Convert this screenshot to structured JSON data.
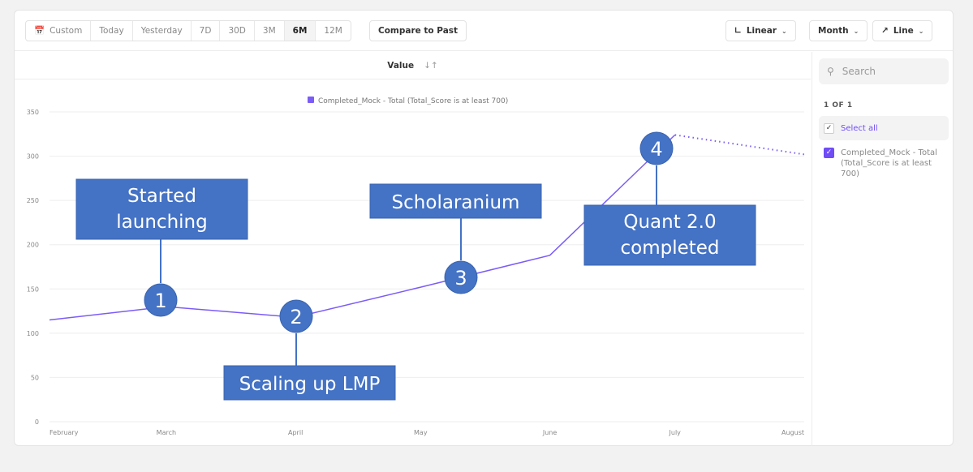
{
  "toolbar": {
    "ranges": [
      "Custom",
      "Today",
      "Yesterday",
      "7D",
      "30D",
      "3M",
      "6M",
      "12M"
    ],
    "active_range": "6M",
    "compare_label": "Compare to Past",
    "scale_label": "Linear",
    "interval_label": "Month",
    "chart_type_label": "Line"
  },
  "value_header": {
    "label": "Value"
  },
  "sidebar": {
    "search_placeholder": "Search",
    "count": "1 OF 1",
    "select_all": "Select all",
    "series_label": "Completed_Mock - Total (Total_Score is at least 700)"
  },
  "colors": {
    "series": "#7b5cf6",
    "annotation": "#4472c4",
    "accent": "#6f4cf5"
  },
  "chart_data": {
    "type": "line",
    "legend": "Completed_Mock - Total (Total_Score is at least 700)",
    "legend_position": "top-center",
    "grid": true,
    "ylim": [
      0,
      350
    ],
    "yticks": [
      0,
      50,
      100,
      150,
      200,
      250,
      300,
      350
    ],
    "xlim": [
      "2023-02-01",
      "2023-08-01"
    ],
    "xticks": [
      {
        "date": "2023-02-01",
        "label": "February"
      },
      {
        "date": "2023-03-01",
        "label": "March"
      },
      {
        "date": "2023-04-01",
        "label": "April"
      },
      {
        "date": "2023-05-01",
        "label": "May"
      },
      {
        "date": "2023-06-01",
        "label": "June"
      },
      {
        "date": "2023-07-01",
        "label": "July"
      },
      {
        "date": "2023-08-01",
        "label": "August"
      }
    ],
    "series": [
      {
        "name": "Completed_Mock - Total (Total_Score is at least 700)",
        "points": [
          {
            "x": "2023-02-01",
            "y": 115
          },
          {
            "x": "2023-03-01",
            "y": 130
          },
          {
            "x": "2023-04-01",
            "y": 118
          },
          {
            "x": "2023-05-01",
            "y": 152
          },
          {
            "x": "2023-06-01",
            "y": 188
          },
          {
            "x": "2023-07-01",
            "y": 324
          },
          {
            "x": "2023-08-01",
            "y": 302,
            "incomplete": true
          }
        ]
      }
    ],
    "annotations": [
      {
        "num": "1",
        "text": "Started launching"
      },
      {
        "num": "2",
        "text": "Scaling up LMP"
      },
      {
        "num": "3",
        "text": "Scholaranium"
      },
      {
        "num": "4",
        "text": "Quant 2.0 completed"
      }
    ]
  }
}
